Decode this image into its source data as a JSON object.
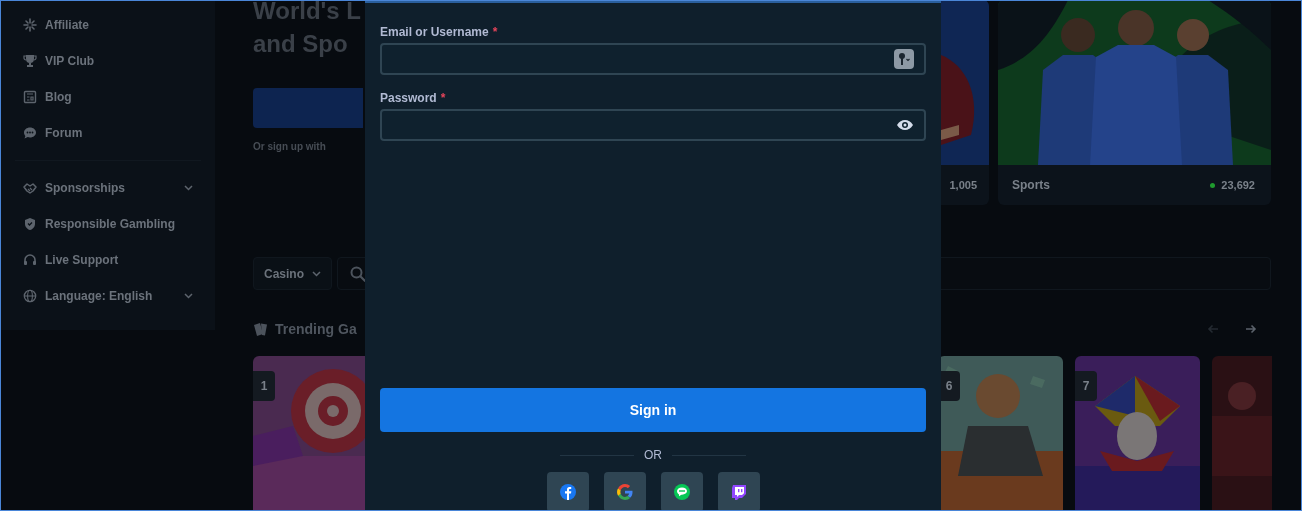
{
  "sidebar": {
    "groups": [
      {
        "items": [
          {
            "label": "Affiliate",
            "has_submenu": false
          },
          {
            "label": "VIP Club",
            "has_submenu": false
          },
          {
            "label": "Blog",
            "has_submenu": false
          },
          {
            "label": "Forum",
            "has_submenu": false
          }
        ]
      },
      {
        "items": [
          {
            "label": "Sponsorships",
            "has_submenu": true
          },
          {
            "label": "Responsible Gambling",
            "has_submenu": false
          },
          {
            "label": "Live Support",
            "has_submenu": false
          },
          {
            "label": "Language: English",
            "has_submenu": true
          }
        ]
      }
    ]
  },
  "hero": {
    "title_lines": [
      "World's L",
      "and Spo"
    ],
    "signup_hint": "Or sign up with"
  },
  "promo_cards": [
    {
      "count": "1,005"
    },
    {
      "label": "Sports",
      "count": "23,692",
      "online": true
    }
  ],
  "filter": {
    "category": "Casino"
  },
  "trending": {
    "title": "Trending Ga",
    "prev_disabled": true,
    "next_disabled": false,
    "games": [
      {
        "rank": "1",
        "kind": "candy"
      },
      {
        "rank": "6",
        "kind": "biker"
      },
      {
        "rank": "7",
        "kind": "jester"
      },
      {
        "kind": "dark"
      }
    ]
  },
  "modal": {
    "fields": [
      {
        "label": "Email or Username",
        "required_mark": "*",
        "kind": "username"
      },
      {
        "label": "Password",
        "required_mark": "*",
        "kind": "password"
      }
    ],
    "submit": "Sign in",
    "divider": "OR",
    "social": [
      {
        "kind": "facebook"
      },
      {
        "kind": "google"
      },
      {
        "kind": "line"
      },
      {
        "kind": "twitch"
      }
    ]
  }
}
